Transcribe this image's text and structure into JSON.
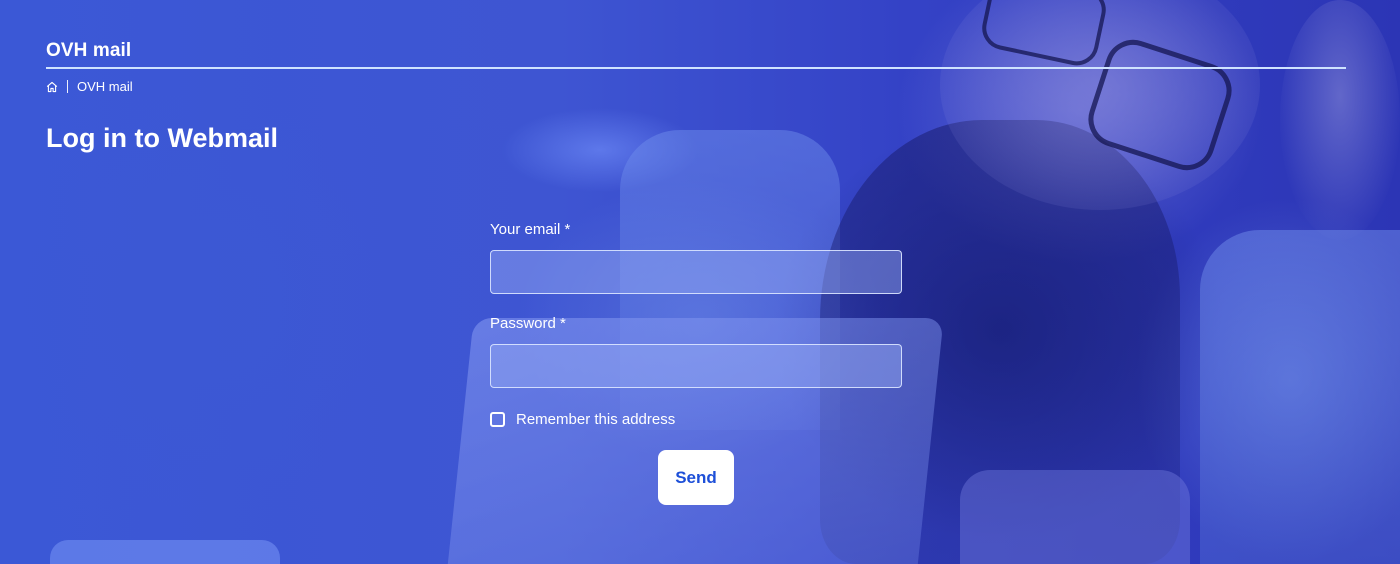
{
  "header": {
    "app_title": "OVH mail"
  },
  "breadcrumb": {
    "home_icon": "home-icon",
    "current": "OVH mail"
  },
  "main": {
    "page_title": "Log in to Webmail"
  },
  "form": {
    "email_label": "Your email *",
    "email_value": "",
    "password_label": "Password *",
    "password_value": "",
    "remember_label": "Remember this address",
    "remember_checked": false,
    "send_label": "Send"
  },
  "colors": {
    "background_overlay": "#3a4fd0",
    "button_background": "#ffffff",
    "button_text": "#1d4fd8",
    "rule": "#cfe3ff"
  }
}
